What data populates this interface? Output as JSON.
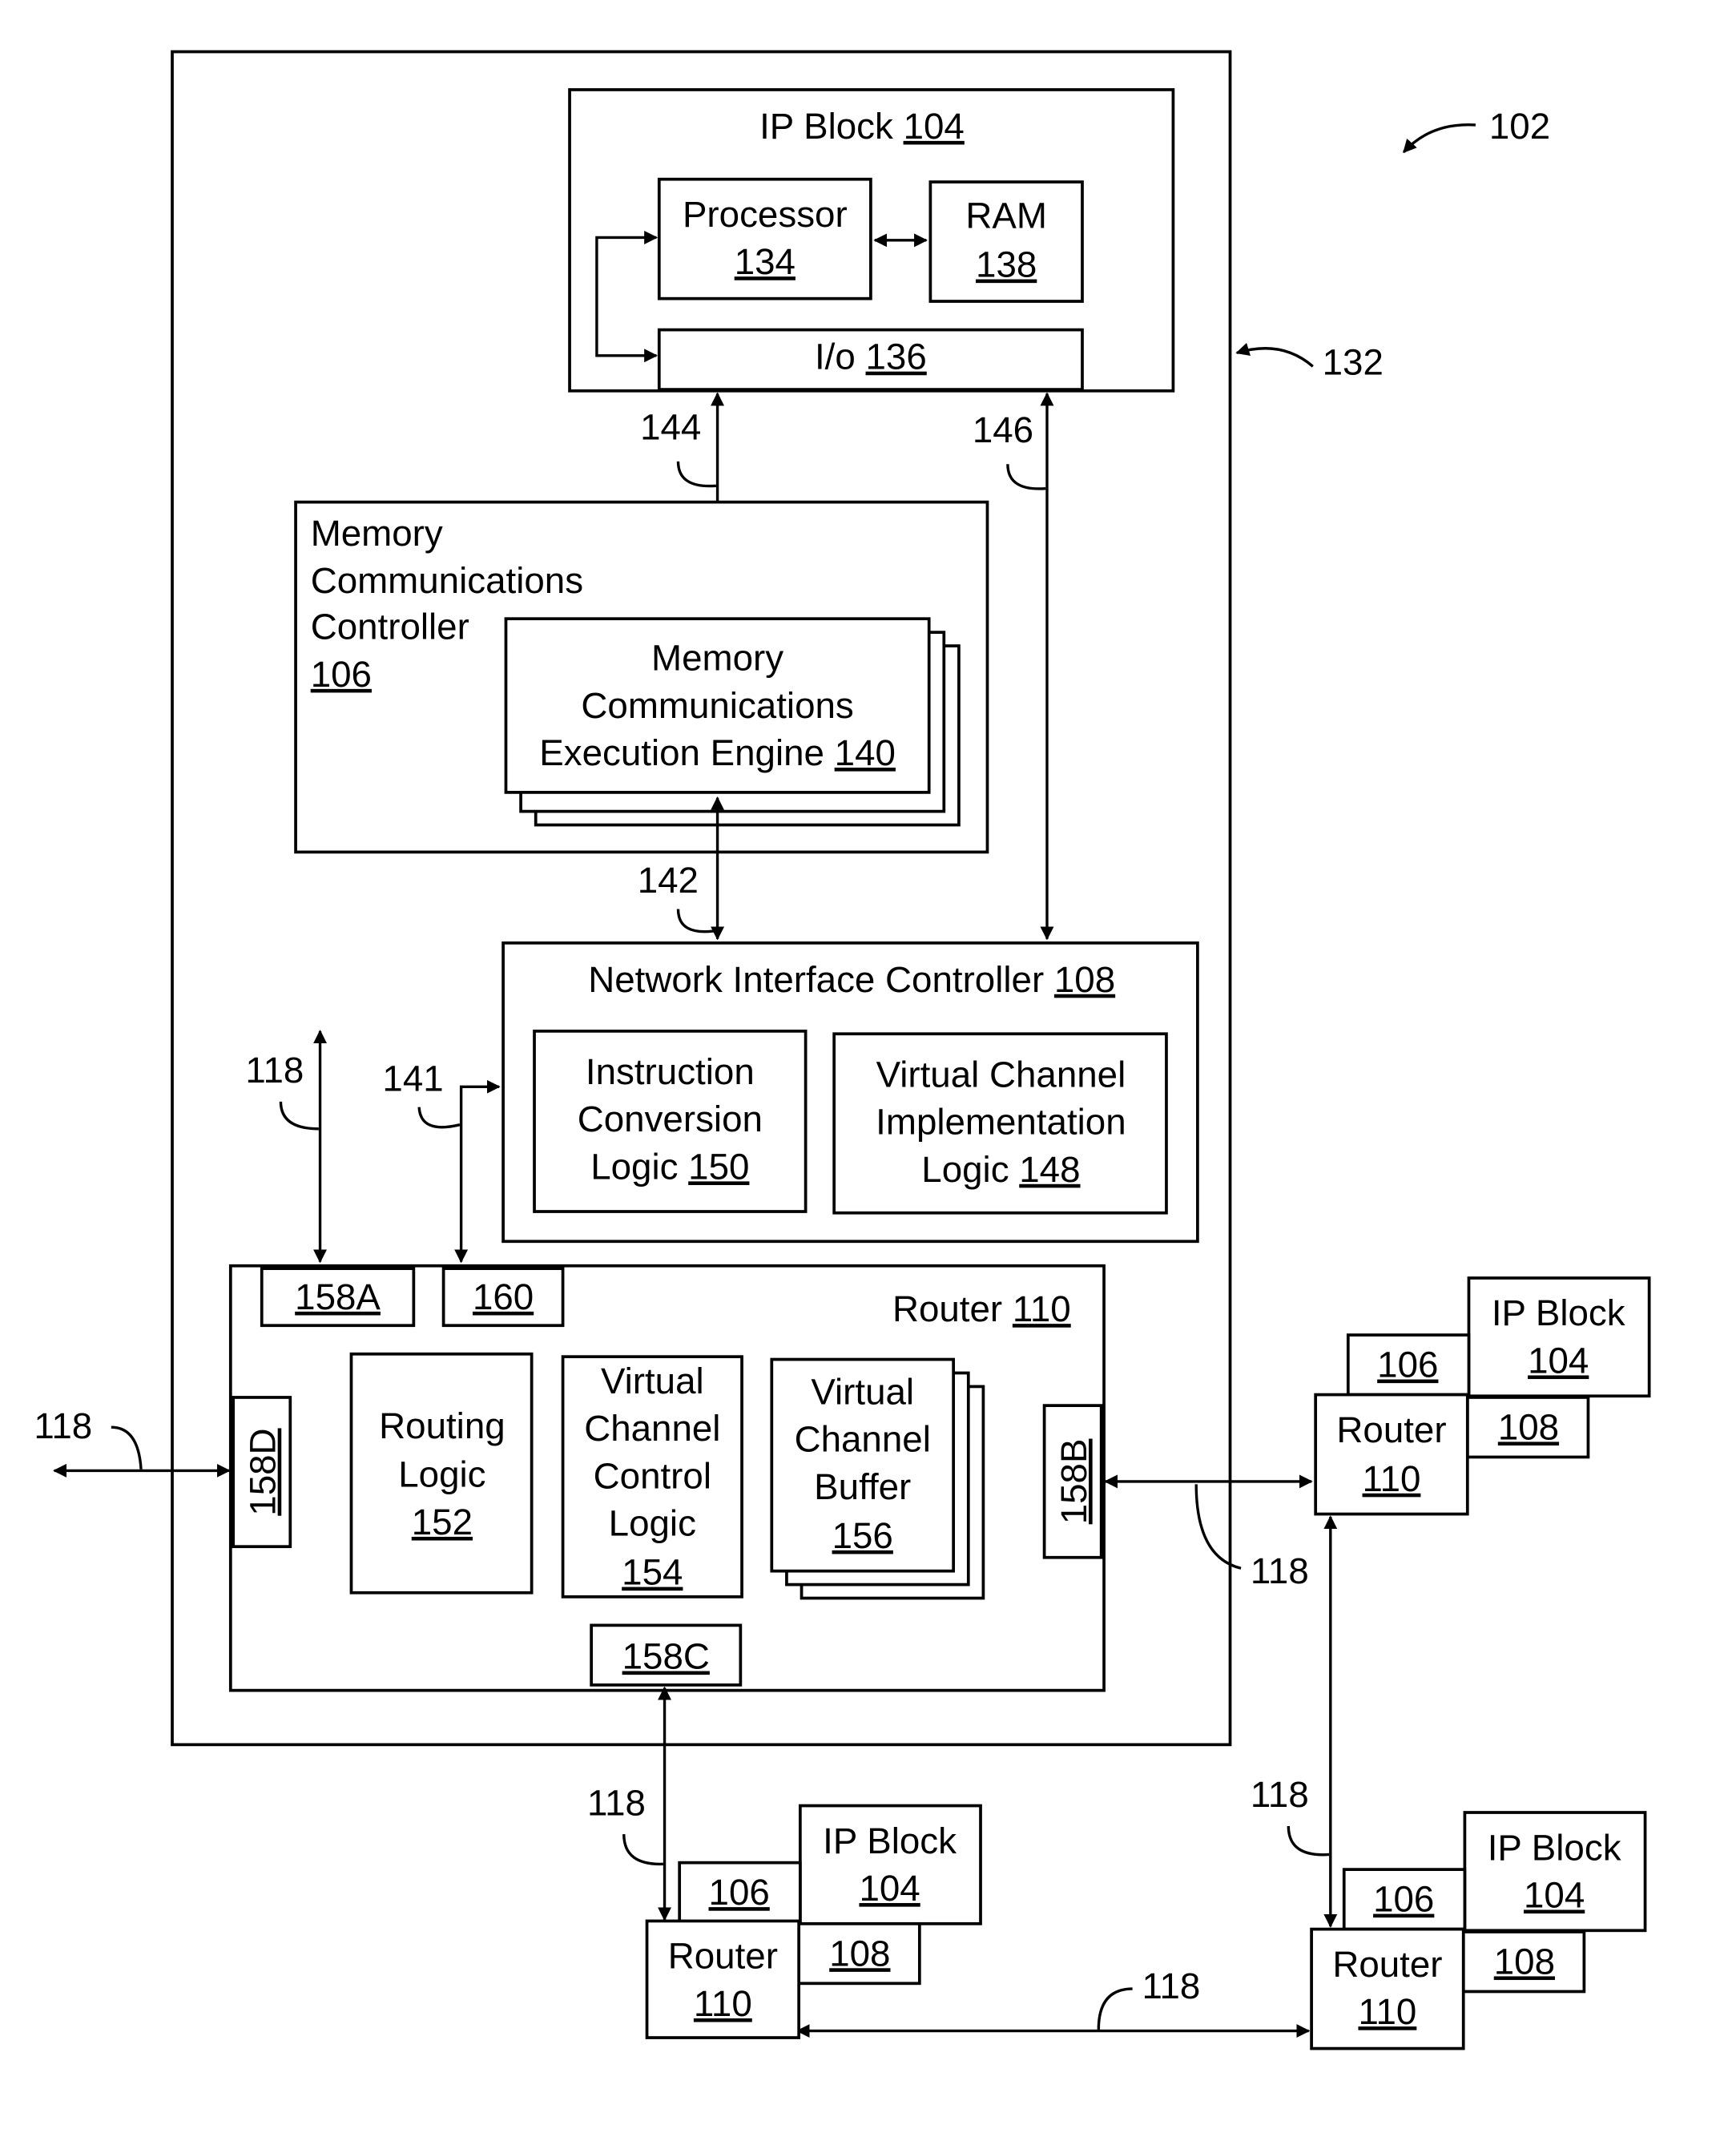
{
  "figure_ref": "102",
  "chip_ref": "132",
  "ip_block": {
    "label": "IP Block",
    "ref": "104"
  },
  "processor": {
    "label": "Processor",
    "ref": "134"
  },
  "ram": {
    "label": "RAM",
    "ref": "138"
  },
  "io": {
    "label": "I/o",
    "ref": "136"
  },
  "mcc": {
    "lines": [
      "Memory",
      "Communications",
      "Controller"
    ],
    "ref": "106"
  },
  "mcee": {
    "lines": [
      "Memory",
      "Communications",
      "Execution Engine"
    ],
    "ref": "140"
  },
  "nic": {
    "label": "Network Interface Controller",
    "ref": "108"
  },
  "icl": {
    "lines": [
      "Instruction",
      "Conversion",
      "Logic"
    ],
    "ref": "150"
  },
  "vcil": {
    "lines": [
      "Virtual Channel",
      "Implementation",
      "Logic"
    ],
    "ref": "148"
  },
  "router": {
    "label": "Router",
    "ref": "110"
  },
  "ports": {
    "a": "158A",
    "b": "158B",
    "c": "158C",
    "d": "158D",
    "p160": "160"
  },
  "routing_logic": {
    "lines": [
      "Routing",
      "Logic"
    ],
    "ref": "152"
  },
  "vccl": {
    "lines": [
      "Virtual",
      "Channel",
      "Control",
      "Logic"
    ],
    "ref": "154"
  },
  "vcb": {
    "lines": [
      "Virtual",
      "Channel",
      "Buffer"
    ],
    "ref": "156"
  },
  "links": {
    "l144": "144",
    "l146": "146",
    "l142": "142",
    "l141": "141",
    "l118": "118"
  },
  "node": {
    "ip_label": "IP Block",
    "ip_ref": "104",
    "mcc_ref": "106",
    "nic_ref": "108",
    "router_label": "Router",
    "router_ref": "110"
  }
}
